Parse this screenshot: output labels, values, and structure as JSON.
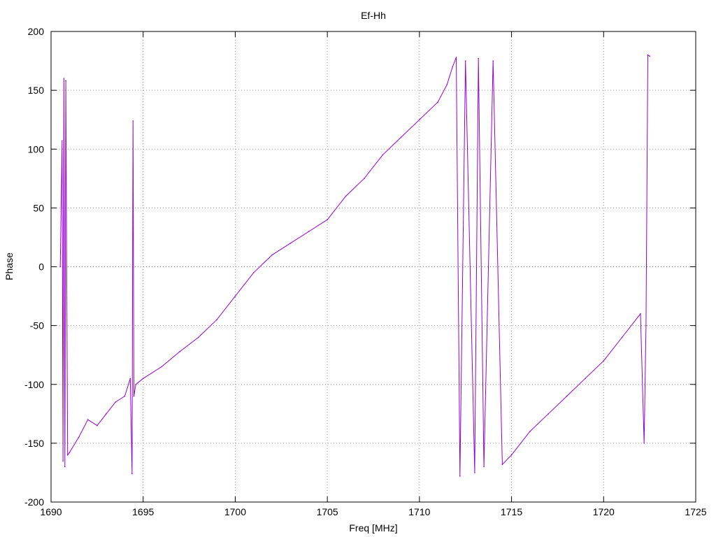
{
  "chart_data": {
    "type": "line",
    "title": "Ef-Hh",
    "xlabel": "Freq [MHz]",
    "ylabel": "Phase",
    "xlim": [
      1690,
      1725
    ],
    "ylim": [
      -200,
      200
    ],
    "xticks": [
      1690,
      1695,
      1700,
      1705,
      1710,
      1715,
      1720,
      1725
    ],
    "yticks": [
      -200,
      -150,
      -100,
      -50,
      0,
      50,
      100,
      150,
      200
    ],
    "grid": true,
    "series": [
      {
        "color": "#9400d3",
        "x": [
          1690.5,
          1690.6,
          1690.65,
          1690.7,
          1690.75,
          1690.8,
          1690.9,
          1691.0,
          1691.5,
          1692.0,
          1692.5,
          1693.0,
          1693.5,
          1694.0,
          1694.3,
          1694.4,
          1694.45,
          1694.5,
          1694.6,
          1695.0,
          1696.0,
          1697.0,
          1698.0,
          1699.0,
          1700.0,
          1701.0,
          1702.0,
          1703.0,
          1704.0,
          1705.0,
          1706.0,
          1707.0,
          1708.0,
          1709.0,
          1710.0,
          1711.0,
          1711.5,
          1711.8,
          1712.0,
          1712.2,
          1712.5,
          1713.0,
          1713.2,
          1713.5,
          1714.0,
          1714.5,
          1715.0,
          1716.0,
          1717.0,
          1718.0,
          1719.0,
          1720.0,
          1721.0,
          1722.0,
          1722.2,
          1722.3,
          1722.4,
          1722.5
        ],
        "y": [
          0,
          107,
          -165,
          160,
          -170,
          158,
          -160,
          -158,
          -145,
          -130,
          -135,
          -125,
          -115,
          -110,
          -95,
          -176,
          124,
          -110,
          -100,
          -95,
          -85,
          -72,
          -60,
          -45,
          -25,
          -5,
          10,
          20,
          30,
          40,
          60,
          75,
          95,
          110,
          125,
          140,
          155,
          170,
          178,
          -178,
          175,
          -175,
          177,
          -170,
          175,
          -168,
          -160,
          -140,
          -125,
          -110,
          -95,
          -80,
          -60,
          -40,
          -150,
          -50,
          180,
          179
        ]
      }
    ]
  }
}
